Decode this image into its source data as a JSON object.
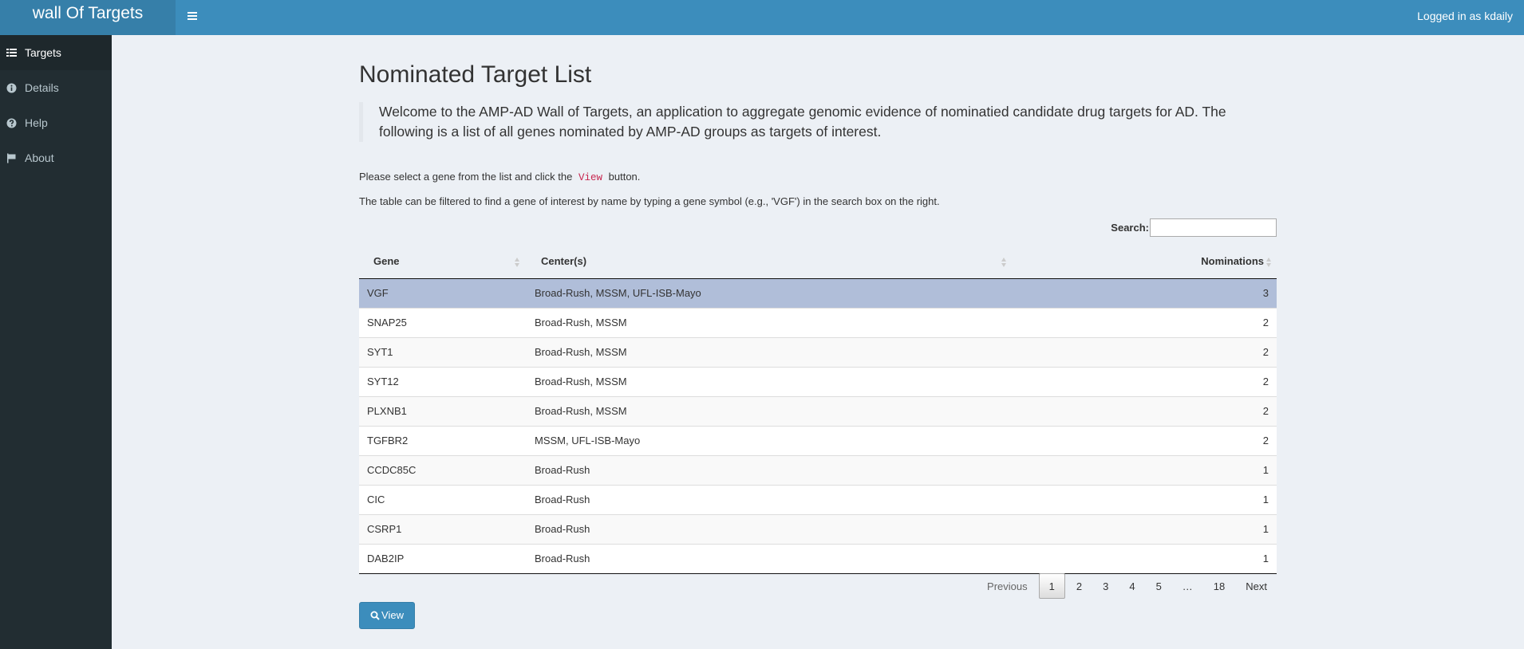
{
  "header": {
    "logo": "wall Of Targets",
    "user": "Logged in as kdaily"
  },
  "sidebar": {
    "items": [
      {
        "label": "Targets",
        "icon": "list-icon"
      },
      {
        "label": "Details",
        "icon": "info-circle-icon"
      },
      {
        "label": "Help",
        "icon": "question-circle-icon"
      },
      {
        "label": "About",
        "icon": "flag-icon"
      }
    ]
  },
  "main": {
    "title": "Nominated Target List",
    "intro": "Welcome to the AMP-AD Wall of Targets, an application to aggregate genomic evidence of nominatied candidate drug targets for AD. The following is a list of all genes nominated by AMP-AD groups as targets of interest.",
    "instruction_before": "Please select a gene from the list and click the",
    "instruction_code": "View",
    "instruction_after": "button.",
    "filter_text": "The table can be filtered to find a gene of interest by name by typing a gene symbol (e.g., 'VGF') in the search box on the right.",
    "search_label": "Search:",
    "search_value": ""
  },
  "table": {
    "columns": [
      "Gene",
      "Center(s)",
      "Nominations"
    ],
    "rows": [
      [
        "VGF",
        "Broad-Rush, MSSM, UFL-ISB-Mayo",
        "3"
      ],
      [
        "SNAP25",
        "Broad-Rush, MSSM",
        "2"
      ],
      [
        "SYT1",
        "Broad-Rush, MSSM",
        "2"
      ],
      [
        "SYT12",
        "Broad-Rush, MSSM",
        "2"
      ],
      [
        "PLXNB1",
        "Broad-Rush, MSSM",
        "2"
      ],
      [
        "TGFBR2",
        "MSSM, UFL-ISB-Mayo",
        "2"
      ],
      [
        "CCDC85C",
        "Broad-Rush",
        "1"
      ],
      [
        "CIC",
        "Broad-Rush",
        "1"
      ],
      [
        "CSRP1",
        "Broad-Rush",
        "1"
      ],
      [
        "DAB2IP",
        "Broad-Rush",
        "1"
      ]
    ]
  },
  "pagination": {
    "previous": "Previous",
    "pages": [
      "1",
      "2",
      "3",
      "4",
      "5",
      "…",
      "18"
    ],
    "next": "Next"
  },
  "view_button": "View",
  "colors": {
    "header": "#3c8dbc",
    "logo_bg": "#367fa9",
    "sidebar": "#222d32",
    "selected_row": "#b0bed9"
  }
}
